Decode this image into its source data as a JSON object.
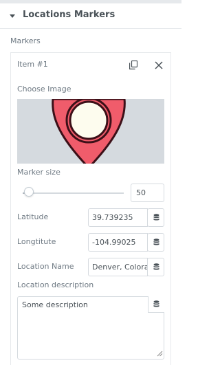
{
  "panel": {
    "title": "Locations Markers"
  },
  "markers": {
    "section_label": "Markers",
    "item": {
      "title": "Item #1",
      "duplicate_icon": "copy-icon",
      "remove_icon": "close-icon",
      "choose_image_label": "Choose Image",
      "marker_size": {
        "label": "Marker size",
        "value": "50",
        "slider_fraction": 0.05
      },
      "latitude": {
        "label": "Latitude",
        "value": "39.739235"
      },
      "longitude": {
        "label": "Longtitute",
        "value": "-104.99025"
      },
      "location_name": {
        "label": "Location Name",
        "value": "Denver, Colorado"
      },
      "location_description": {
        "label": "Location description",
        "value": "Some description"
      },
      "dynamic_icon": "database-icon"
    }
  },
  "colors": {
    "marker_red": "#f05c6b",
    "marker_outline": "#3c1018",
    "marker_inner": "#fdfcee"
  }
}
